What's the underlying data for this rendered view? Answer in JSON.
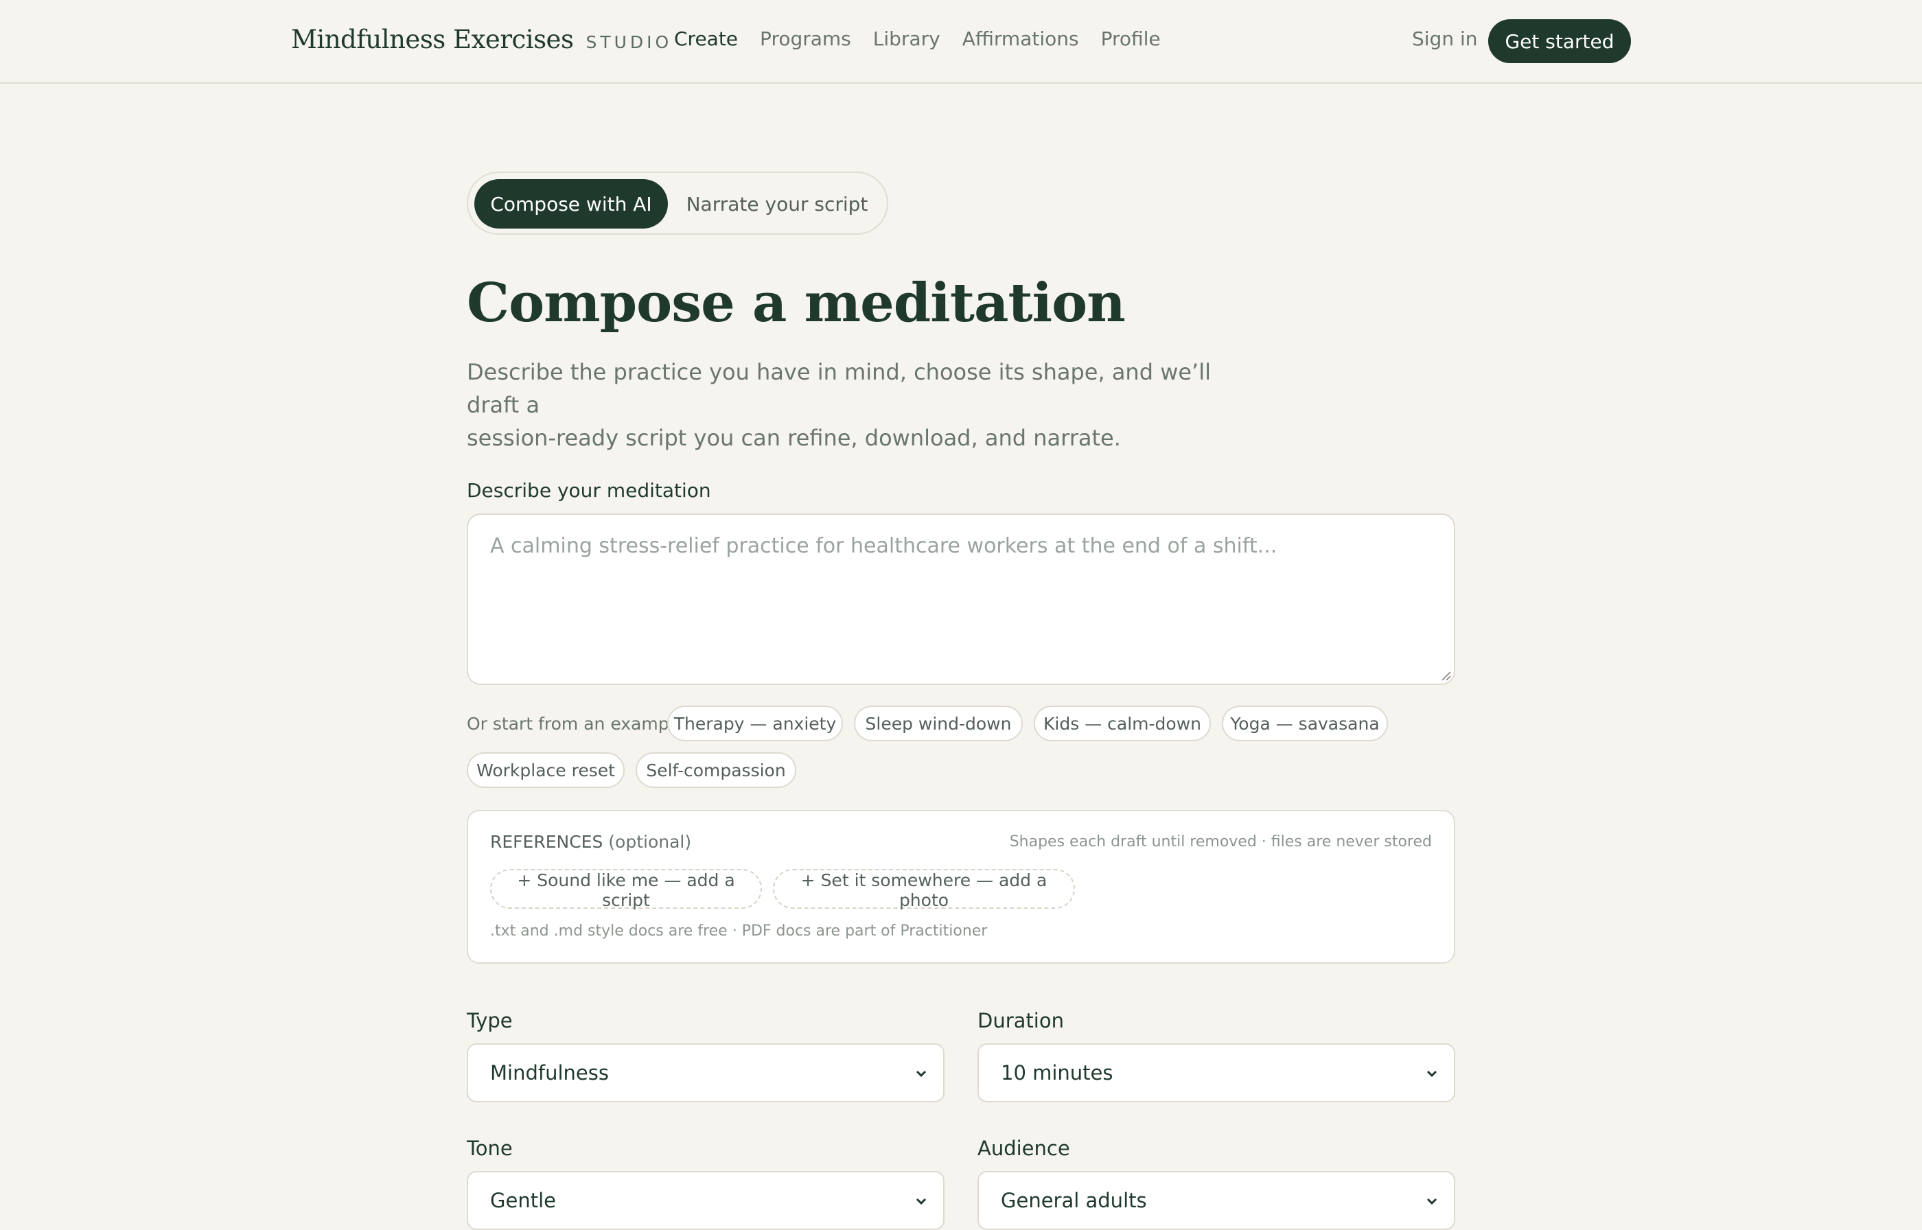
{
  "header": {
    "brand_name": "Mindfulness Exercises",
    "brand_suffix": "STUDIO",
    "nav": [
      "Create",
      "Programs",
      "Library",
      "Affirmations",
      "Profile"
    ],
    "active_nav": "Create",
    "sign_in": "Sign in",
    "get_started": "Get started"
  },
  "mode": {
    "active": "Compose with AI",
    "inactive": "Narrate your script"
  },
  "main": {
    "title": "Compose a meditation",
    "subtitle_line1": "Describe the practice you have in mind, choose its shape, and we’ll draft a",
    "subtitle_line2": "session-ready script you can refine, download, and narrate."
  },
  "description": {
    "label": "Describe your meditation",
    "placeholder": "A calming stress-relief practice for healthcare workers at the end of a shift...",
    "value": ""
  },
  "examples": {
    "label": "Or start from an example:",
    "chips": [
      "Therapy — anxiety",
      "Sleep wind-down",
      "Kids — calm-down",
      "Yoga — savasana",
      "Workplace reset",
      "Self-compassion"
    ]
  },
  "references": {
    "title": "REFERENCES",
    "optional": "(optional)",
    "note": "Shapes each draft until removed · files are never stored",
    "add_script": "+ Sound like me — add a script",
    "add_photo": "+ Set it somewhere — add a photo",
    "footnote": ".txt and .md style docs are free · PDF docs are part of Practitioner"
  },
  "options": {
    "type_label": "Type",
    "type_value": "Mindfulness",
    "duration_label": "Duration",
    "duration_value": "10 minutes",
    "tone_label": "Tone",
    "tone_value": "Gentle",
    "audience_label": "Audience",
    "audience_value": "General adults"
  },
  "colors": {
    "background": "#f6f4ee",
    "accent": "#1f3a2c",
    "muted_text": "#6a756f"
  }
}
